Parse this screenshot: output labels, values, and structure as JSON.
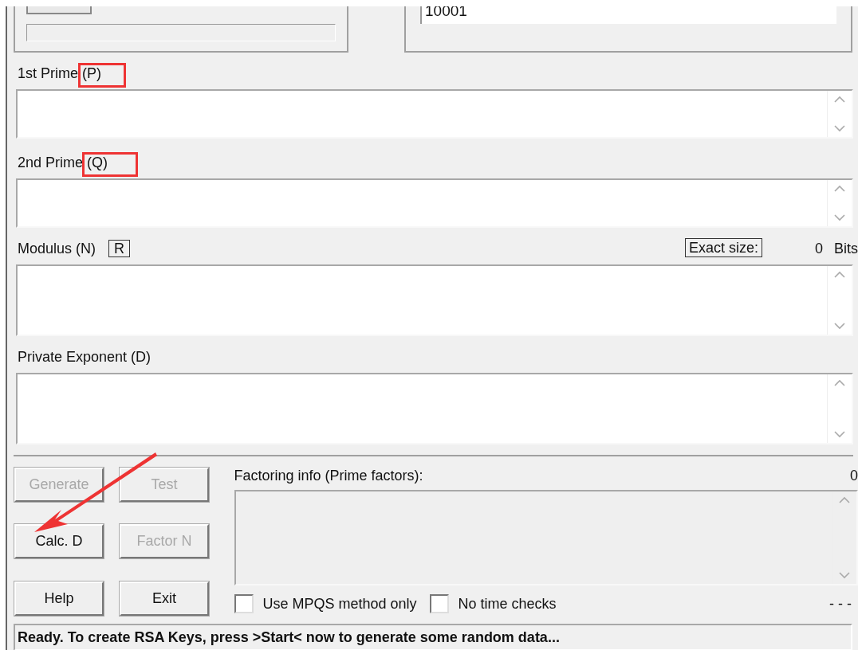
{
  "progress": {
    "level": 0
  },
  "public_exponent": {
    "value": "10001"
  },
  "arrow_annotation": true,
  "fields": [
    {
      "label": "1st Prime (P)",
      "kind": "prime",
      "highlighted": true
    },
    {
      "label": "2nd Prime (Q)",
      "kind": "prime",
      "highlighted": true
    },
    {
      "label": "Modulus (N)",
      "kind": "modulus",
      "highlighted": false
    },
    {
      "label": "Private Exponent (D)",
      "kind": "exponent",
      "highlighted": false
    }
  ],
  "modulus": {
    "r_button": "R",
    "exact_size_label": "Exact size:",
    "bits_value": "0",
    "bits_unit": "Bits"
  },
  "buttons": [
    {
      "label": "Generate",
      "disabled": true
    },
    {
      "label": "Test",
      "disabled": true
    },
    {
      "label": "Calc. D",
      "disabled": false
    },
    {
      "label": "Factor N",
      "disabled": true
    },
    {
      "label": "Help",
      "disabled": false
    },
    {
      "label": "Exit",
      "disabled": false
    }
  ],
  "factoring": {
    "label": "Factoring info (Prime factors):",
    "count": "0",
    "disabled": true
  },
  "options": [
    {
      "label": "Use MPQS method only",
      "checked": false
    },
    {
      "label": "No time checks",
      "checked": false
    }
  ],
  "elapsed": "- - -",
  "status": "Ready. To create RSA Keys, press >Start< now to generate some random data..."
}
